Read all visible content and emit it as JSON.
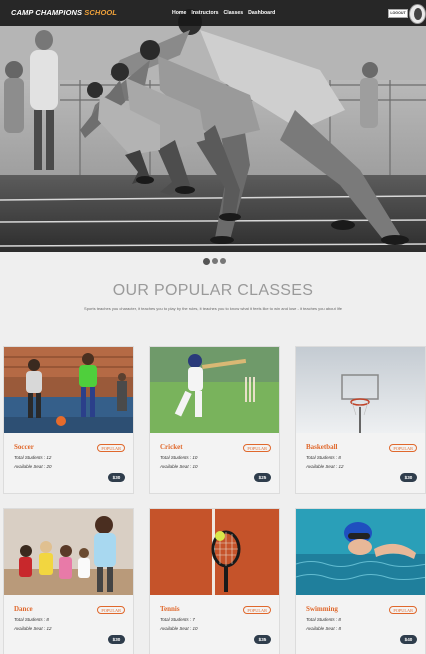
{
  "nav": {
    "brand_main": "CAMP CHAMPIONS",
    "brand_accent": " SCHOOL",
    "links": [
      "Home",
      "Instructors",
      "Classes",
      "Dashboard"
    ],
    "button_label": "LOGOUT",
    "avatar_icon": "user-avatar-icon"
  },
  "carousel": {
    "slides": 3,
    "active": 0
  },
  "section": {
    "title": "OUR POPULAR CLASSES",
    "subtitle": "Sports teaches you character, it teaches you to play by the rules, it teaches you to know what it feels like to win and lose - it teaches you about life"
  },
  "classes": [
    {
      "name": "Soccer",
      "badge": "POPULAR",
      "students": "Total Students : 12",
      "seats": "Available Seat : 20",
      "price": "$30"
    },
    {
      "name": "Cricket",
      "badge": "POPULAR",
      "students": "Total Students : 10",
      "seats": "Available Seat : 10",
      "price": "$25"
    },
    {
      "name": "Basketball",
      "badge": "POPULAR",
      "students": "Total Students : 8",
      "seats": "Available Seat : 12",
      "price": "$30"
    },
    {
      "name": "Dance",
      "badge": "POPULAR",
      "students": "Total Students : 8",
      "seats": "Available Seat : 12",
      "price": "$30"
    },
    {
      "name": "Tennis",
      "badge": "POPULAR",
      "students": "Total Students : 7",
      "seats": "Available Seat : 10",
      "price": "$35"
    },
    {
      "name": "Swimming",
      "badge": "POPULAR",
      "students": "Total Students : 8",
      "seats": "Available Seat : 8",
      "price": "$40"
    }
  ],
  "colors": {
    "accent": "#e0682c",
    "brand_accent": "#f0a23a",
    "price_bg": "#2f3d4c"
  }
}
